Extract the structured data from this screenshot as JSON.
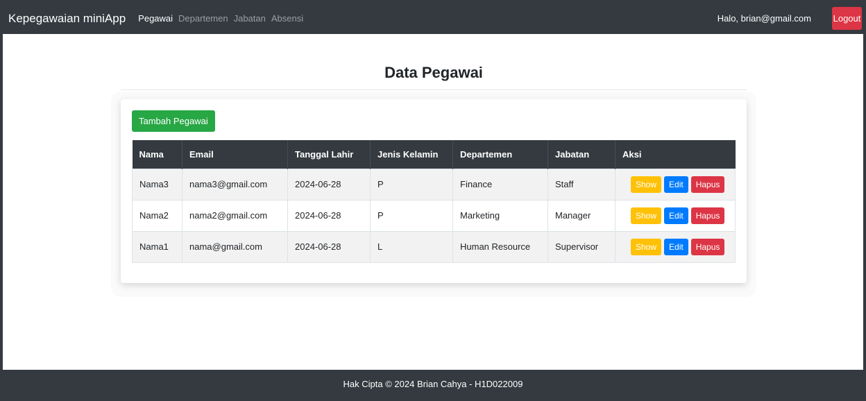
{
  "navbar": {
    "brand": "Kepegawaian miniApp",
    "links": [
      "Pegawai",
      "Departemen",
      "Jabatan",
      "Absensi"
    ],
    "greeting": "Halo, brian@gmail.com",
    "logout_label": "Logout"
  },
  "main": {
    "title": "Data Pegawai",
    "add_button_label": "Tambah Pegawai",
    "table": {
      "headers": [
        "Nama",
        "Email",
        "Tanggal Lahir",
        "Jenis Kelamin",
        "Departemen",
        "Jabatan",
        "Aksi"
      ],
      "rows": [
        [
          "Nama3",
          "nama3@gmail.com",
          "2024-06-28",
          "P",
          "Finance",
          "Staff"
        ],
        [
          "Nama2",
          "nama2@gmail.com",
          "2024-06-28",
          "P",
          "Marketing",
          "Manager"
        ],
        [
          "Nama1",
          "nama@gmail.com",
          "2024-06-28",
          "L",
          "Human Resource",
          "Supervisor"
        ]
      ],
      "actions": {
        "show": "Show",
        "edit": "Edit",
        "delete": "Hapus"
      }
    }
  },
  "footer": {
    "text": "Hak Cipta © 2024 Brian Cahya - H1D022009"
  },
  "colors": {
    "navbar_bg": "#343a40",
    "success": "#28a745",
    "warning": "#ffc107",
    "primary": "#007bff",
    "danger": "#dc3545"
  }
}
